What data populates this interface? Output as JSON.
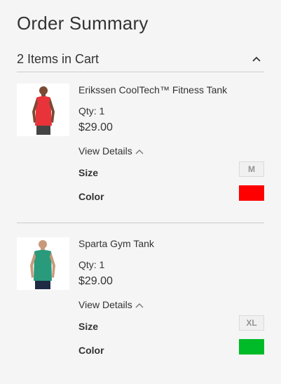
{
  "summary": {
    "title": "Order Summary",
    "items_in_cart": "2 Items in Cart"
  },
  "items": [
    {
      "name": "Erikssen CoolTech™ Fitness Tank",
      "qty": "Qty: 1",
      "price": "$29.00",
      "view_details": "View Details",
      "size_label": "Size",
      "size_value": "M",
      "color_label": "Color",
      "color_hex": "#ff0000",
      "shirt_color": "#e8333a"
    },
    {
      "name": "Sparta Gym Tank",
      "qty": "Qty: 1",
      "price": "$29.00",
      "view_details": "View Details",
      "size_label": "Size",
      "size_value": "XL",
      "color_label": "Color",
      "color_hex": "#00bb28",
      "shirt_color": "#2a9a7c"
    }
  ],
  "icons": {
    "collapse": "chevron-up-icon",
    "details_toggle": "chevron-up-icon"
  }
}
